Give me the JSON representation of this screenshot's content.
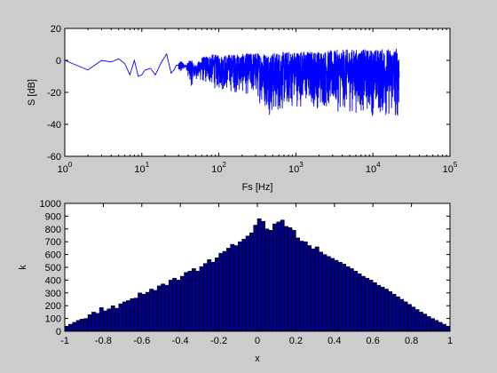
{
  "chart_data": [
    {
      "type": "line",
      "xlabel": "Fs [Hz]",
      "ylabel": "S [dB]",
      "xscale": "log",
      "xlim": [
        1,
        100000
      ],
      "ylim": [
        -60,
        20
      ],
      "yticks": [
        20,
        0,
        -20,
        -40,
        -60
      ],
      "yticklabels": [
        "20",
        "0",
        "-20",
        "-40",
        "-60"
      ],
      "xticks": [
        1,
        10,
        100,
        1000,
        10000,
        100000
      ],
      "xtick_base": "10",
      "xtick_exponents": [
        "0",
        "1",
        "2",
        "3",
        "4",
        "5"
      ],
      "line_color": "#0000ff",
      "x_end": 22050,
      "series": [
        {
          "x": [
            1,
            2,
            3,
            4,
            5,
            6,
            7,
            8,
            9,
            10,
            11,
            13,
            15,
            18,
            21,
            24,
            28,
            32,
            37,
            43,
            50,
            60,
            70,
            85,
            100,
            150,
            200,
            300,
            500,
            1000,
            2000,
            5000,
            10000,
            22050
          ],
          "y_upper": [
            0,
            -6,
            0,
            -1,
            1,
            -2,
            -9,
            0,
            -10,
            -9,
            -6,
            -5,
            -9,
            -1,
            4,
            -8,
            -3,
            0,
            -3,
            1,
            -3,
            2,
            3,
            4,
            3,
            4,
            4,
            5,
            5,
            6,
            6,
            7,
            7,
            8
          ],
          "y_lower": [
            0,
            -6,
            0,
            -1,
            1,
            -2,
            -9,
            0,
            -10,
            -9,
            -6,
            -5,
            -9,
            -1,
            4,
            -8,
            -6,
            -10,
            -4,
            -18,
            -12,
            -15,
            -16,
            -18,
            -20,
            -21,
            -22,
            -25,
            -37,
            -30,
            -32,
            -34,
            -36,
            -40
          ]
        }
      ]
    },
    {
      "type": "bar",
      "xlabel": "x",
      "ylabel": "k",
      "xlim": [
        -1,
        1
      ],
      "ylim": [
        0,
        1000
      ],
      "xticks": [
        -1,
        -0.8,
        -0.6,
        -0.4,
        -0.2,
        0,
        0.2,
        0.4,
        0.6,
        0.8,
        1
      ],
      "xticklabels": [
        "-1",
        "-0.8",
        "-0.6",
        "-0.4",
        "-0.2",
        "0",
        "0.2",
        "0.4",
        "0.6",
        "0.8",
        "1"
      ],
      "yticks": [
        0,
        100,
        200,
        300,
        400,
        500,
        600,
        700,
        800,
        900,
        1000
      ],
      "yticklabels": [
        "0",
        "100",
        "200",
        "300",
        "400",
        "500",
        "600",
        "700",
        "800",
        "900",
        "1000"
      ],
      "bar_color": "#000080",
      "bin_width": 0.02,
      "values": [
        40,
        55,
        70,
        85,
        95,
        100,
        130,
        150,
        140,
        185,
        160,
        175,
        200,
        180,
        215,
        230,
        240,
        255,
        260,
        300,
        290,
        305,
        330,
        320,
        355,
        370,
        360,
        400,
        415,
        400,
        430,
        460,
        470,
        490,
        470,
        505,
        530,
        560,
        540,
        575,
        610,
        625,
        650,
        680,
        670,
        700,
        720,
        745,
        770,
        830,
        880,
        860,
        800,
        790,
        840,
        855,
        870,
        820,
        810,
        790,
        730,
        705,
        700,
        670,
        645,
        660,
        620,
        600,
        585,
        570,
        555,
        540,
        525,
        505,
        490,
        470,
        450,
        430,
        415,
        400,
        380,
        360,
        345,
        330,
        310,
        290,
        270,
        250,
        230,
        210,
        190,
        170,
        150,
        135,
        115,
        100,
        85,
        70,
        55,
        40
      ]
    }
  ]
}
